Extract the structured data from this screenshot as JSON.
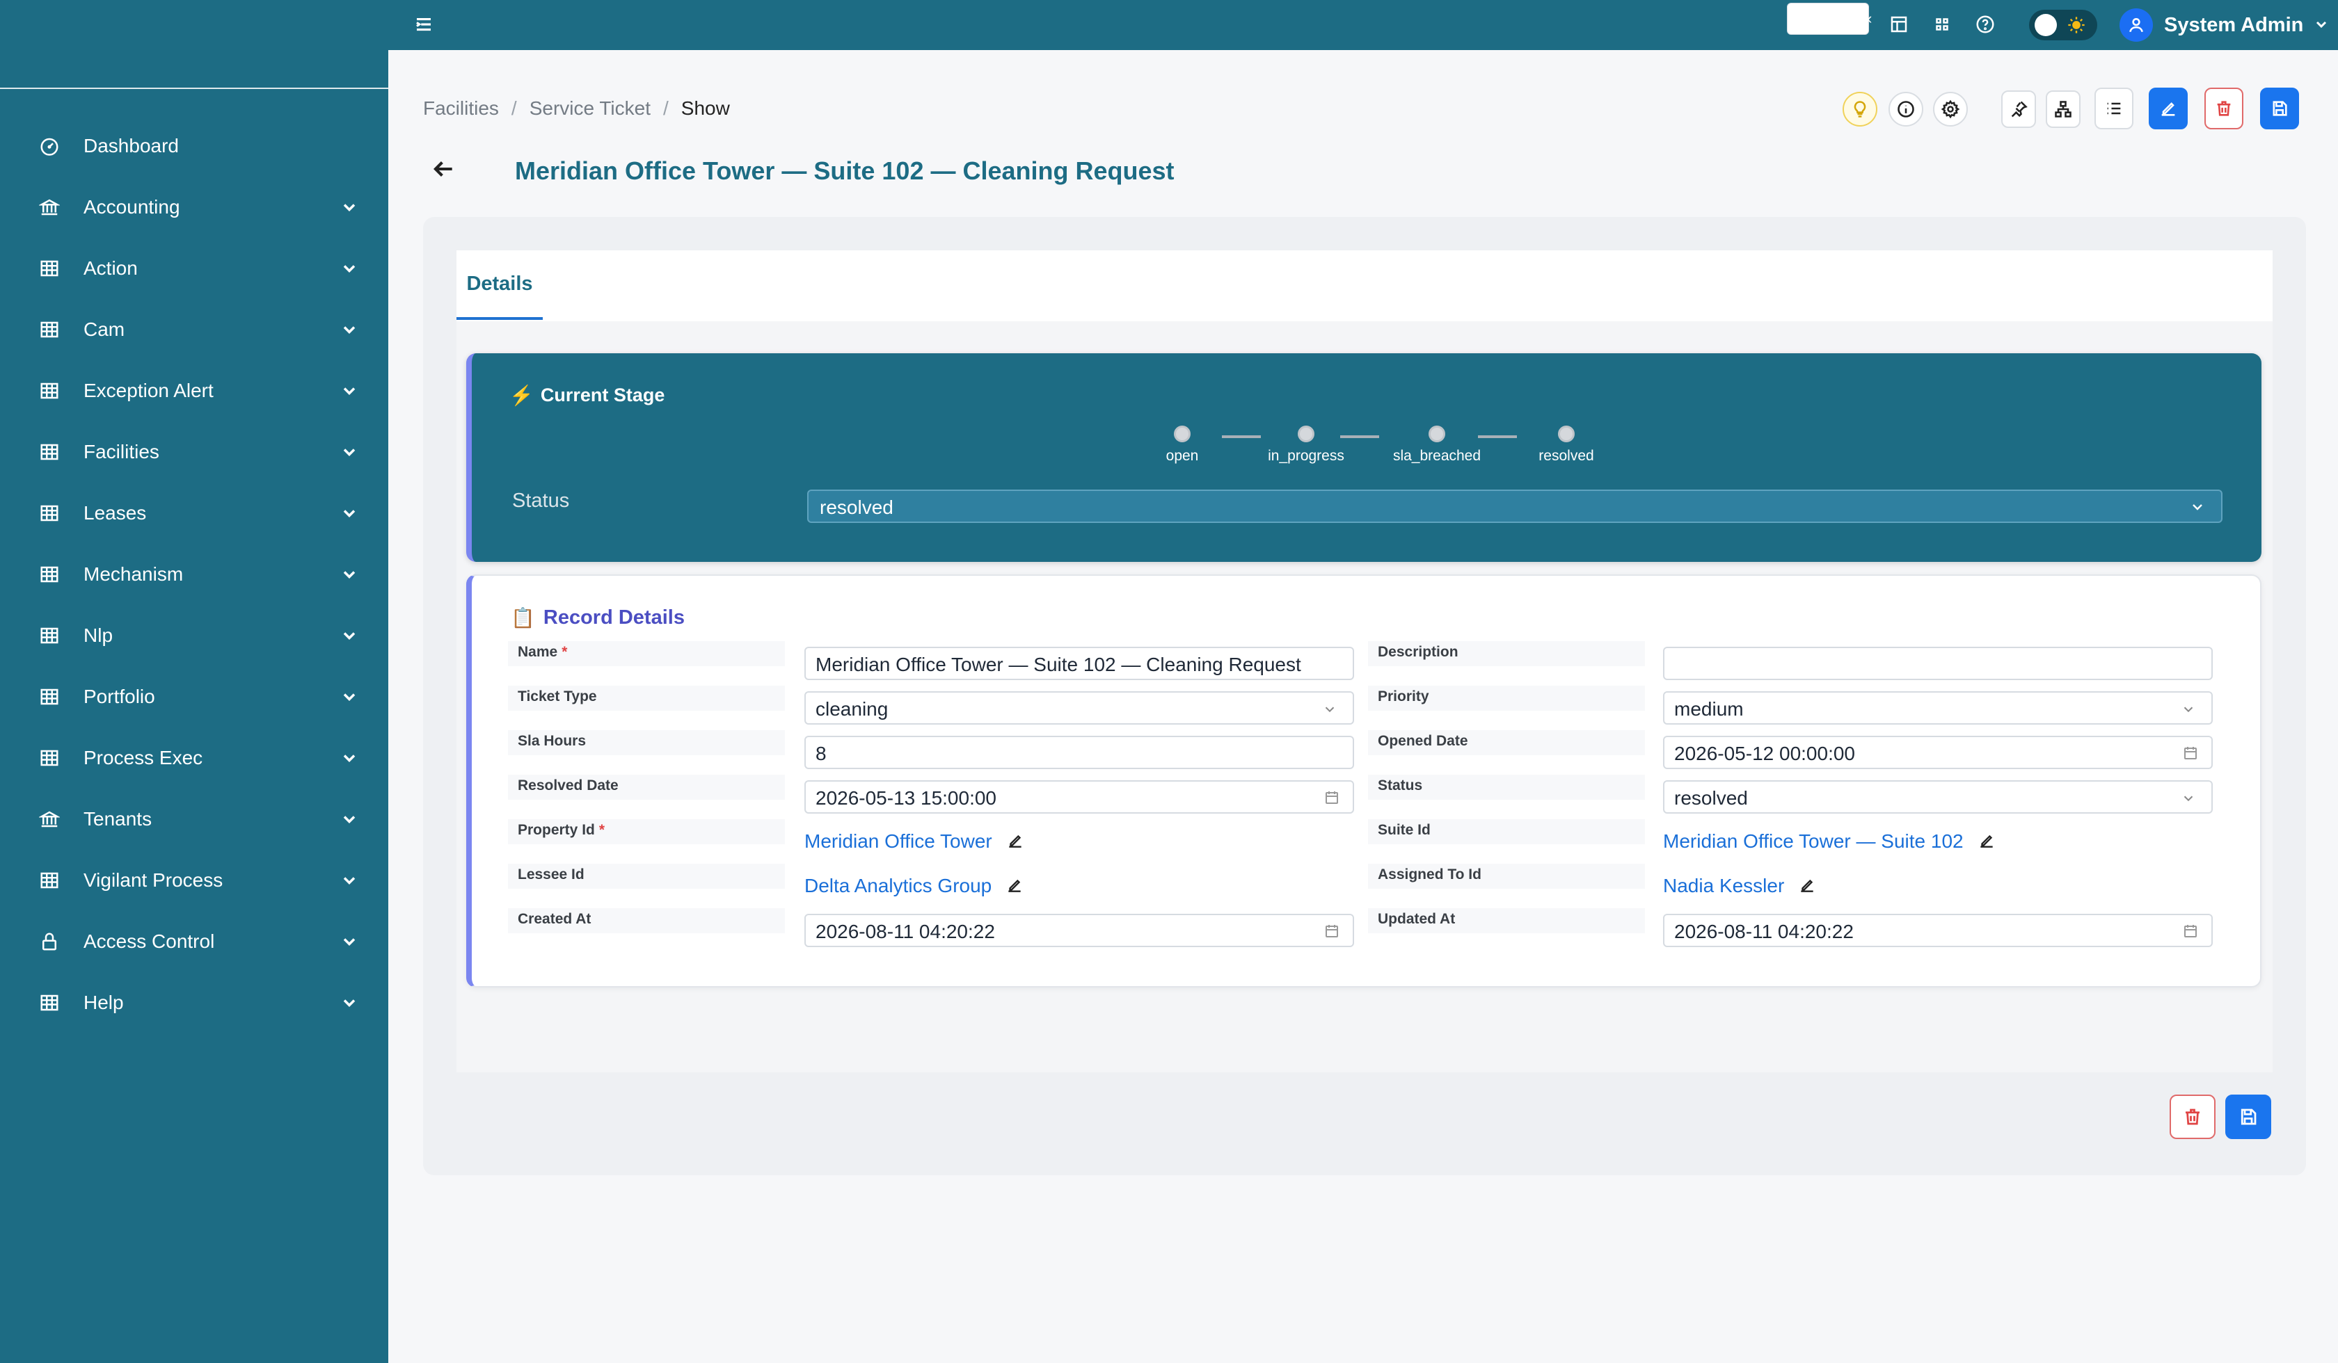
{
  "sidebar": {
    "items": [
      {
        "label": "Dashboard",
        "icon": "dashboard-icon",
        "has_children": false
      },
      {
        "label": "Accounting",
        "icon": "bank-icon",
        "has_children": true
      },
      {
        "label": "Action",
        "icon": "table-icon",
        "has_children": true
      },
      {
        "label": "Cam",
        "icon": "table-icon",
        "has_children": true
      },
      {
        "label": "Exception Alert",
        "icon": "table-icon",
        "has_children": true
      },
      {
        "label": "Facilities",
        "icon": "table-icon",
        "has_children": true
      },
      {
        "label": "Leases",
        "icon": "table-icon",
        "has_children": true
      },
      {
        "label": "Mechanism",
        "icon": "table-icon",
        "has_children": true
      },
      {
        "label": "Nlp",
        "icon": "table-icon",
        "has_children": true
      },
      {
        "label": "Portfolio",
        "icon": "table-icon",
        "has_children": true
      },
      {
        "label": "Process Exec",
        "icon": "table-icon",
        "has_children": true
      },
      {
        "label": "Tenants",
        "icon": "bank-icon",
        "has_children": true
      },
      {
        "label": "Vigilant Process",
        "icon": "table-icon",
        "has_children": true
      },
      {
        "label": "Access Control",
        "icon": "lock-icon",
        "has_children": true
      },
      {
        "label": "Help",
        "icon": "table-icon",
        "has_children": true
      }
    ]
  },
  "topbar": {
    "user_name": "System Admin"
  },
  "breadcrumb": {
    "items": [
      "Facilities",
      "Service Ticket"
    ],
    "current": "Show"
  },
  "page": {
    "title": "Meridian Office Tower — Suite 102 — Cleaning Request"
  },
  "tabs": [
    {
      "label": "Details",
      "active": true
    }
  ],
  "stage": {
    "title": "Current Stage",
    "steps": [
      "open",
      "in_progress",
      "sla_breached",
      "resolved"
    ],
    "status_label": "Status",
    "status_value": "resolved"
  },
  "record": {
    "title": "Record Details",
    "fields": {
      "name": {
        "label": "Name",
        "value": "Meridian Office Tower — Suite 102 — Cleaning Request",
        "required": true
      },
      "description": {
        "label": "Description",
        "value": ""
      },
      "ticket_type": {
        "label": "Ticket Type",
        "value": "cleaning"
      },
      "priority": {
        "label": "Priority",
        "value": "medium"
      },
      "sla_hours": {
        "label": "Sla Hours",
        "value": "8"
      },
      "opened_date": {
        "label": "Opened Date",
        "value": "2026-05-12 00:00:00"
      },
      "resolved_date": {
        "label": "Resolved Date",
        "value": "2026-05-13 15:00:00"
      },
      "status": {
        "label": "Status",
        "value": "resolved"
      },
      "property_id": {
        "label": "Property Id",
        "value": "Meridian Office Tower",
        "required": true
      },
      "suite_id": {
        "label": "Suite Id",
        "value": "Meridian Office Tower — Suite 102"
      },
      "lessee_id": {
        "label": "Lessee Id",
        "value": "Delta Analytics Group"
      },
      "assigned_to_id": {
        "label": "Assigned To Id",
        "value": "Nadia Kessler"
      },
      "created_at": {
        "label": "Created At",
        "value": "2026-08-11 04:20:22"
      },
      "updated_at": {
        "label": "Updated At",
        "value": "2026-08-11 04:20:22"
      }
    },
    "required_mark": "*"
  },
  "colors": {
    "primary": "#1d6c84",
    "accent_blue": "#1a75ee",
    "danger": "#e04444",
    "link": "#1a6fd8",
    "card_border": "#7b86f0"
  }
}
